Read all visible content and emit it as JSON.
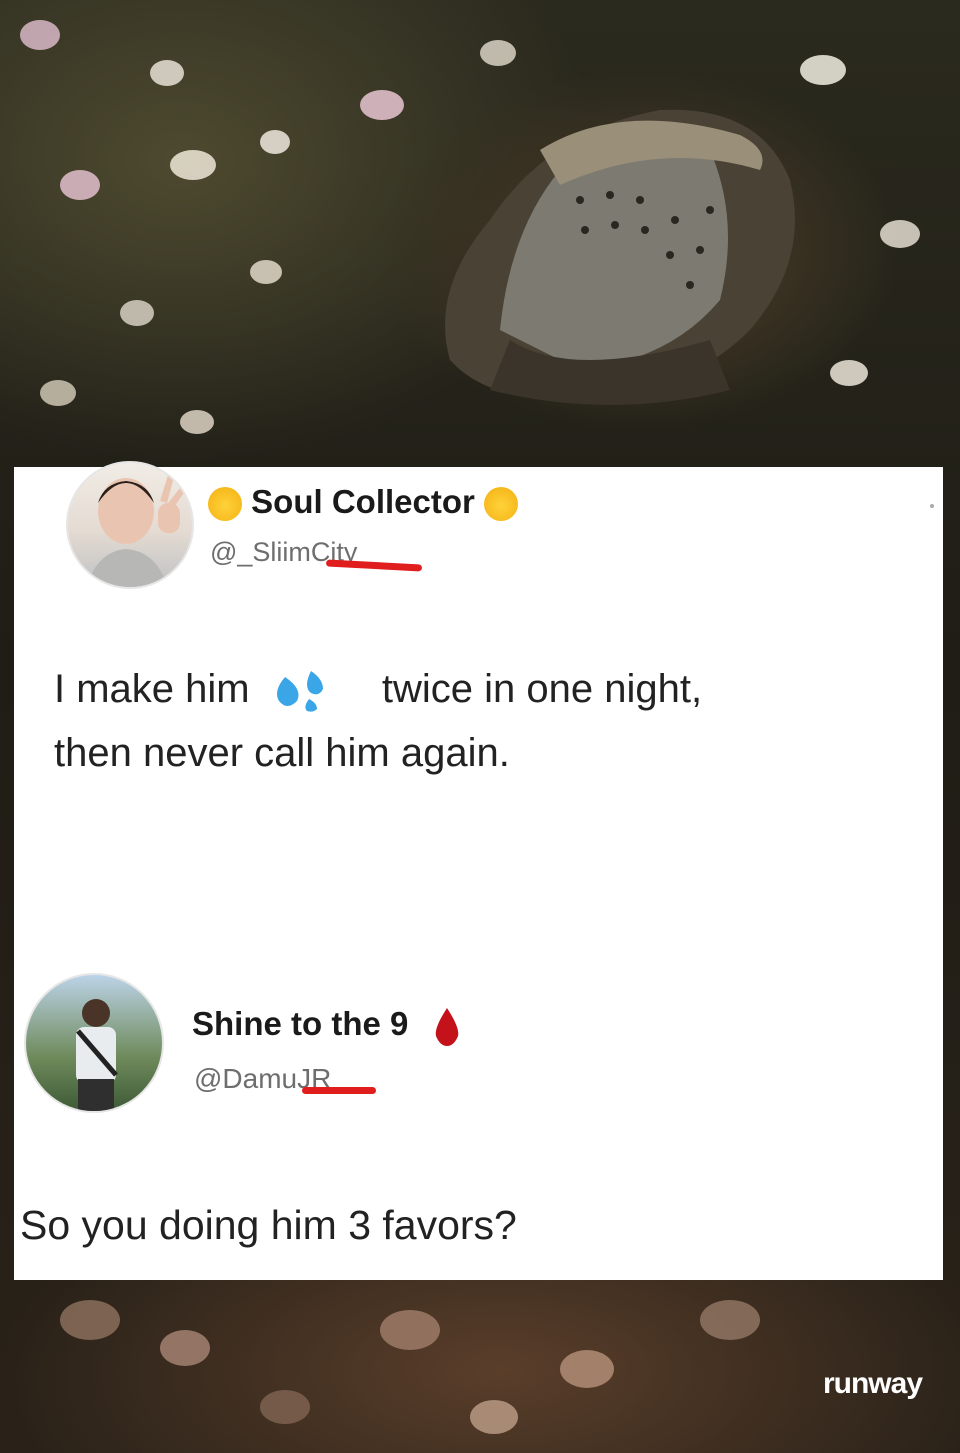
{
  "tweet1": {
    "name": "Soul Collector",
    "handle": "@_SliimCity",
    "text_line1_a": "I make him",
    "text_line1_b": "twice in one night,",
    "text_line2": "then never call him again.",
    "name_emoji": "sleeping-face-emoji",
    "inline_emoji": "sweat-droplets-emoji"
  },
  "tweet2": {
    "name": "Shine to the 9",
    "handle": "@DamuJR",
    "name_emoji": "drop-of-blood-emoji",
    "text": "So you doing him 3 favors?"
  },
  "watermark": "runway",
  "colors": {
    "redaction": "#e01e1e",
    "droplet": "#3aa6e8",
    "blood": "#c4121a"
  }
}
